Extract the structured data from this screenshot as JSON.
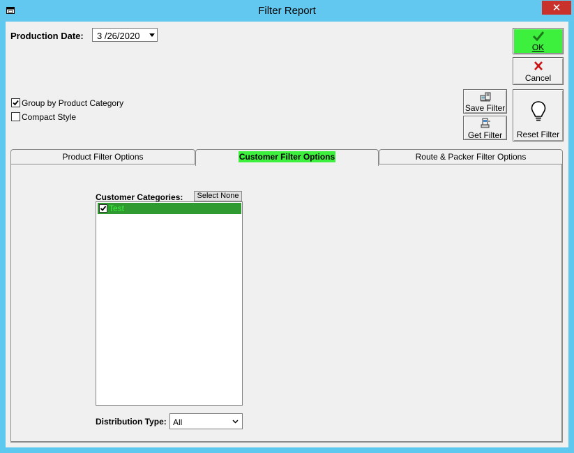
{
  "window": {
    "title": "Filter Report",
    "close_glyph": "✕"
  },
  "production_date": {
    "label": "Production Date:",
    "value": "3 /26/2020"
  },
  "options": {
    "group_by": {
      "label": "Group by Product Category",
      "checked": true
    },
    "compact": {
      "label": "Compact Style",
      "checked": false
    }
  },
  "buttons": {
    "ok": "OK",
    "cancel": "Cancel",
    "save_filter": "Save Filter",
    "get_filter": "Get Filter",
    "reset_filter": "Reset Filter"
  },
  "tabs": [
    {
      "label": "Product Filter Options",
      "active": false
    },
    {
      "label": "Customer Filter Options",
      "active": true
    },
    {
      "label": "Route & Packer Filter Options",
      "active": false
    }
  ],
  "customer_categories": {
    "label": "Customer Categories:",
    "select_none": "Select None",
    "items": [
      {
        "label": "Test",
        "checked": true
      }
    ]
  },
  "distribution_type": {
    "label": "Distribution Type:",
    "value": "All"
  },
  "colors": {
    "accent_green": "#3ef03e",
    "titlebar": "#62c8ef",
    "close_red": "#c9312b"
  }
}
